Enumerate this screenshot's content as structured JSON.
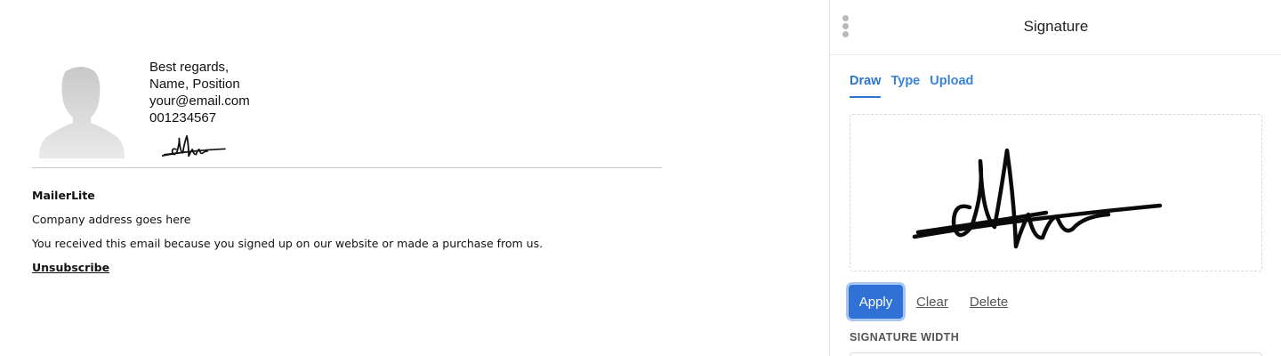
{
  "email": {
    "signature_lines": [
      "Best regards,",
      "Name, Position",
      "your@email.com",
      "001234567"
    ],
    "footer": {
      "company": "MailerLite",
      "address": "Company address goes here",
      "notice": "You received this email because you signed up on our website or made a purchase from us.",
      "unsubscribe": "Unsubscribe"
    }
  },
  "panel": {
    "title": "Signature",
    "tabs": [
      {
        "label": "Draw",
        "active": true
      },
      {
        "label": "Type",
        "active": false
      },
      {
        "label": "Upload",
        "active": false
      }
    ],
    "actions": {
      "apply": "Apply",
      "clear": "Clear",
      "delete": "Delete"
    },
    "width_label": "SIGNATURE WIDTH"
  },
  "colors": {
    "accent": "#2f71d4",
    "tab": "#3a83d6",
    "ink": "#111111"
  },
  "icons": {
    "drag_handle": "drag-handle-icon",
    "avatar": "avatar-placeholder"
  }
}
